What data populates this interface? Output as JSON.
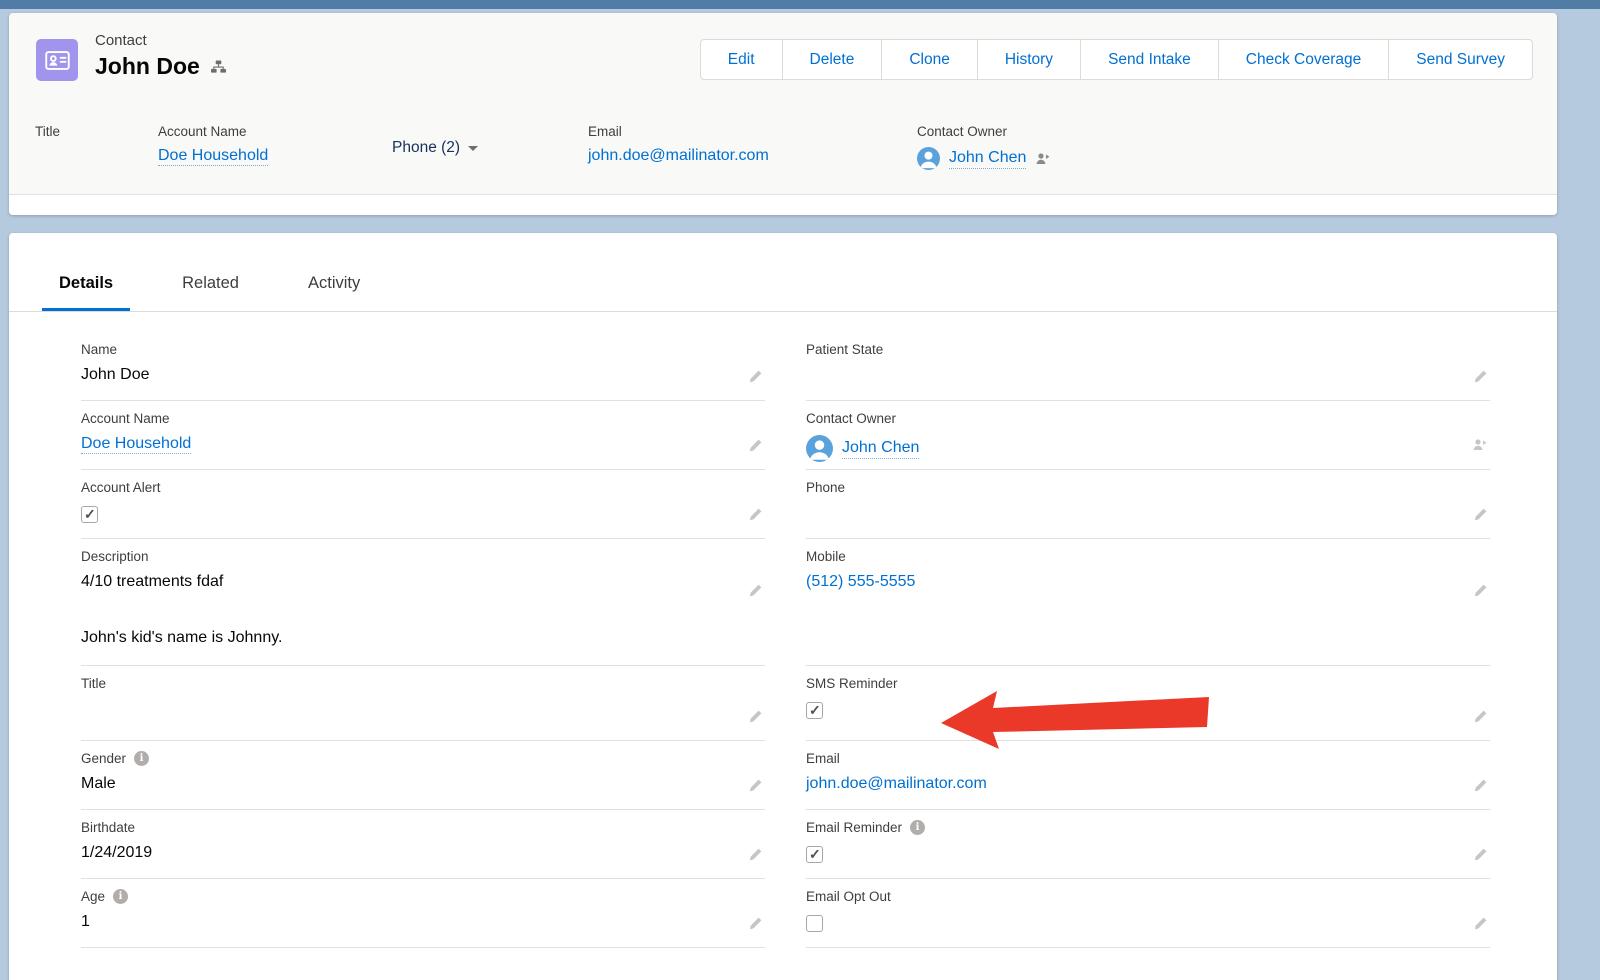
{
  "colors": {
    "link": "#0070d2",
    "contact_icon_bg": "#a094ed",
    "tab_underline": "#0070d2",
    "arrow_annotation": "#ea3829",
    "page_background": "#b6cadf"
  },
  "header": {
    "entity_label": "Contact",
    "record_name": "John Doe",
    "actions": [
      "Edit",
      "Delete",
      "Clone",
      "History",
      "Send Intake",
      "Check Coverage",
      "Send Survey"
    ]
  },
  "highlights": {
    "title": {
      "label": "Title",
      "value": ""
    },
    "account": {
      "label": "Account Name",
      "value": "Doe Household"
    },
    "phone": {
      "label": "Phone (2)"
    },
    "email": {
      "label": "Email",
      "value": "john.doe@mailinator.com"
    },
    "owner": {
      "label": "Contact Owner",
      "value": "John Chen"
    }
  },
  "tabs": {
    "active": "Details",
    "items": [
      {
        "label": "Details"
      },
      {
        "label": "Related"
      },
      {
        "label": "Activity"
      }
    ]
  },
  "details": {
    "left": [
      {
        "label": "Name",
        "value": "John Doe",
        "type": "text"
      },
      {
        "label": "Account Name",
        "value": "Doe Household",
        "type": "link"
      },
      {
        "label": "Account Alert",
        "type": "checkbox",
        "checked": true
      },
      {
        "label": "Description",
        "type": "multiline",
        "lines": [
          "4/10 treatments fdaf",
          "John's kid's name is Johnny."
        ]
      },
      {
        "label": "Title",
        "value": "",
        "type": "text"
      },
      {
        "label": "Gender",
        "value": "Male",
        "type": "text",
        "info": true
      },
      {
        "label": "Birthdate",
        "value": "1/24/2019",
        "type": "text"
      },
      {
        "label": "Age",
        "value": "1",
        "type": "text",
        "info": true
      }
    ],
    "right": [
      {
        "label": "Patient State",
        "value": "",
        "type": "text"
      },
      {
        "label": "Contact Owner",
        "value": "John Chen",
        "type": "owner"
      },
      {
        "label": "Phone",
        "value": "",
        "type": "text"
      },
      {
        "label": "Mobile",
        "value": "(512) 555-5555",
        "type": "link"
      },
      {
        "label": "SMS Reminder",
        "type": "checkbox",
        "checked": true
      },
      {
        "label": "Email",
        "value": "john.doe@mailinator.com",
        "type": "link"
      },
      {
        "label": "Email Reminder",
        "type": "checkbox",
        "checked": true,
        "info": true
      },
      {
        "label": "Email Opt Out",
        "type": "checkbox",
        "checked": false
      }
    ]
  }
}
